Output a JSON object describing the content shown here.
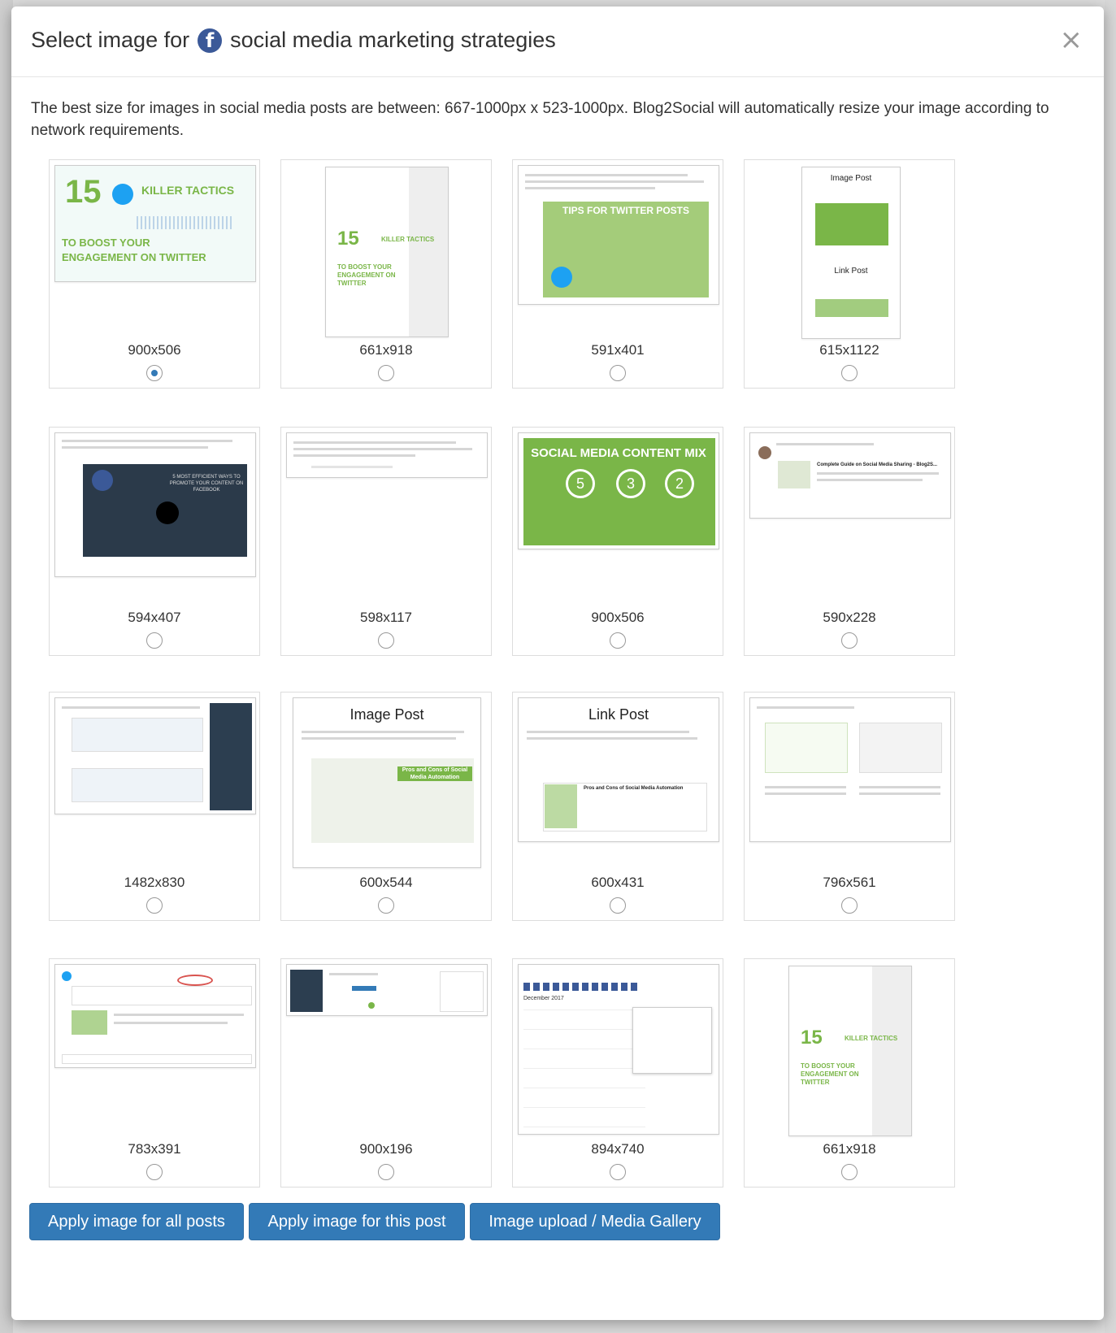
{
  "modal": {
    "title_prefix": "Select image for",
    "title_suffix": "social media marketing strategies",
    "fb_glyph": "f",
    "close_glyph": "×",
    "info": "The best size for images in social media posts are between: 667-1000px x 523-1000px. Blog2Social will automatically resize your image according to network requirements."
  },
  "images": [
    {
      "size": "900x506",
      "selected": true,
      "thumb_text": "KILLER TACTICS",
      "thumb_text2": "TO BOOST YOUR ENGAGEMENT ON TWITTER",
      "thumb_num": "15"
    },
    {
      "size": "661x918",
      "selected": false,
      "thumb_text": "KILLER TACTICS",
      "thumb_text2": "TO BOOST YOUR ENGAGEMENT ON TWITTER",
      "thumb_num": "15"
    },
    {
      "size": "591x401",
      "selected": false,
      "thumb_text": "TIPS FOR TWITTER POSTS"
    },
    {
      "size": "615x1122",
      "selected": false,
      "thumb_text": "Image Post",
      "thumb_text2": "Link Post"
    },
    {
      "size": "594x407",
      "selected": false,
      "thumb_text": "5 MOST EFFICIENT WAYS TO PROMOTE YOUR CONTENT ON FACEBOOK"
    },
    {
      "size": "598x117",
      "selected": false
    },
    {
      "size": "900x506",
      "selected": false,
      "thumb_text": "SOCIAL MEDIA CONTENT MIX",
      "nums": [
        "5",
        "3",
        "2"
      ]
    },
    {
      "size": "590x228",
      "selected": false,
      "thumb_text": "Complete Guide on Social Media Sharing - Blog2S..."
    },
    {
      "size": "1482x830",
      "selected": false
    },
    {
      "size": "600x544",
      "selected": false,
      "thumb_text": "Image Post",
      "thumb_text2": "Pros and Cons of Social Media Automation"
    },
    {
      "size": "600x431",
      "selected": false,
      "thumb_text": "Link Post",
      "thumb_text2": "Pros and Cons of Social Media Automation"
    },
    {
      "size": "796x561",
      "selected": false
    },
    {
      "size": "783x391",
      "selected": false
    },
    {
      "size": "900x196",
      "selected": false
    },
    {
      "size": "894x740",
      "selected": false,
      "thumb_text": "December 2017"
    },
    {
      "size": "661x918",
      "selected": false,
      "thumb_text": "KILLER TACTICS",
      "thumb_text2": "TO BOOST YOUR ENGAGEMENT ON TWITTER",
      "thumb_num": "15"
    }
  ],
  "buttons": {
    "apply_all": "Apply image for all posts",
    "apply_this": "Apply image for this post",
    "upload": "Image upload / Media Gallery"
  },
  "colors": {
    "primary": "#337ab7",
    "facebook": "#3b5998",
    "brand_green": "#7ab648"
  }
}
